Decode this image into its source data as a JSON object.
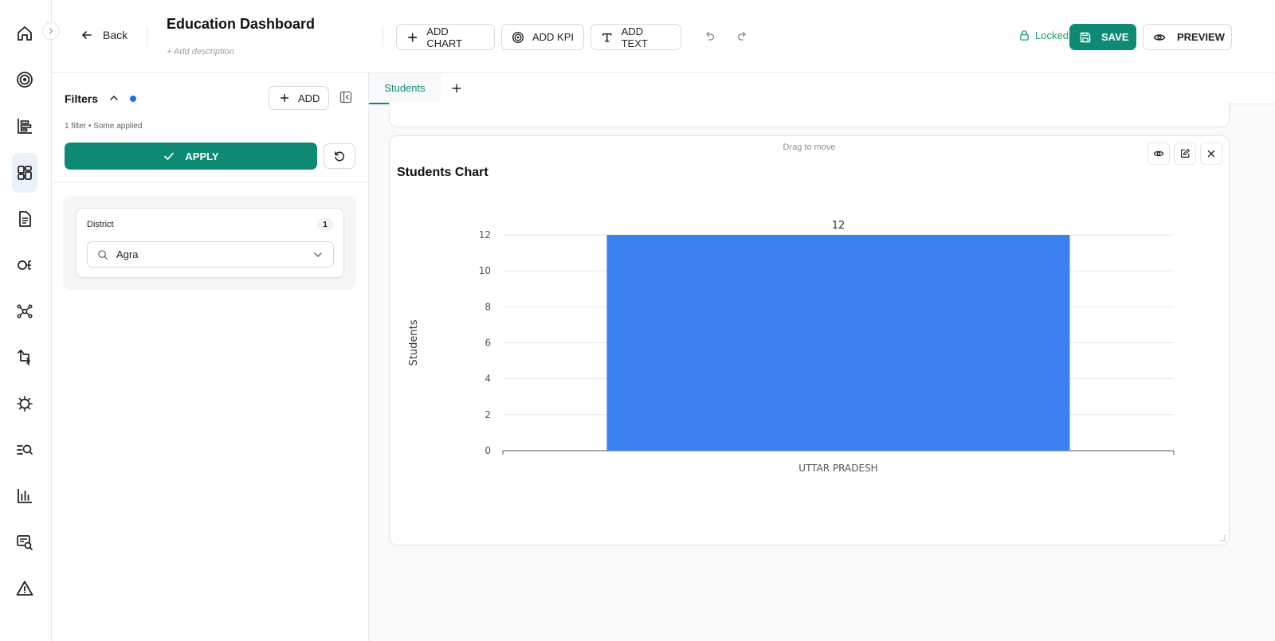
{
  "header": {
    "back_label": "Back",
    "title": "Education Dashboard",
    "description_placeholder": "+ Add description",
    "add_chart_label": "ADD CHART",
    "add_kpi_label": "ADD KPI",
    "add_text_label": "ADD TEXT",
    "locked_label": "Locked for editing",
    "save_label": "SAVE",
    "preview_label": "PREVIEW"
  },
  "sidebar": {
    "items": [
      {
        "icon": "home-icon"
      },
      {
        "icon": "target-icon"
      },
      {
        "icon": "list-chart-icon"
      },
      {
        "icon": "dashboard-icon",
        "active": true
      },
      {
        "icon": "document-icon"
      },
      {
        "icon": "flow-icon"
      },
      {
        "icon": "network-icon"
      },
      {
        "icon": "transform-icon"
      },
      {
        "icon": "virus-icon"
      },
      {
        "icon": "search-list-icon"
      },
      {
        "icon": "bar-chart-icon"
      },
      {
        "icon": "report-search-icon"
      },
      {
        "icon": "warning-icon"
      }
    ]
  },
  "filters": {
    "title": "Filters",
    "add_label": "ADD",
    "summary": "1 filter • Some applied",
    "apply_label": "APPLY",
    "items": [
      {
        "label": "District",
        "count": "1",
        "value": "Agra"
      }
    ]
  },
  "tabs": [
    {
      "label": "Students",
      "active": true
    }
  ],
  "widget": {
    "drag_hint": "Drag to move",
    "title": "Students Chart"
  },
  "colors": {
    "accent": "#0e8a74",
    "bar": "#3b82f0",
    "locked": "#14a266"
  },
  "chart_data": {
    "type": "bar",
    "title": "Students Chart",
    "categories": [
      "UTTAR PRADESH"
    ],
    "values": [
      12
    ],
    "data_labels": [
      "12"
    ],
    "xlabel": "",
    "ylabel": "Students",
    "ylim": [
      0,
      12
    ],
    "yticks": [
      0,
      2,
      4,
      6,
      8,
      10,
      12
    ],
    "grid": true
  }
}
